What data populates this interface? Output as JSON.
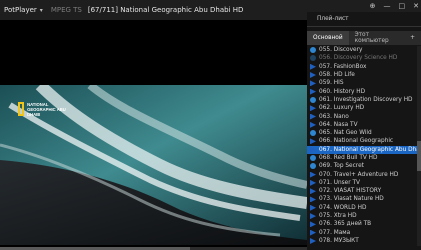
{
  "app": {
    "name": "PotPlayer",
    "format": "MPEG TS",
    "title": "[67/711] National Geographic Abu Dhabi HD"
  },
  "video": {
    "logo": "NATIONAL GEOGRAPHIC ABU DHABI",
    "progress": 0.62
  },
  "panel": {
    "title": "Плей-лист",
    "tabs": [
      {
        "label": "Основной",
        "active": true
      },
      {
        "label": "Этот компьютер",
        "active": false
      }
    ],
    "add_label": "+",
    "items": [
      {
        "label": "055. Discovery",
        "icon": "ie"
      },
      {
        "label": "056. Discovery Science HD",
        "icon": "ie",
        "dim": true
      },
      {
        "label": "057. FashionBox",
        "icon": "file"
      },
      {
        "label": "058. HD Life",
        "icon": "file"
      },
      {
        "label": "059. HIS",
        "icon": "file"
      },
      {
        "label": "060. History HD",
        "icon": "file"
      },
      {
        "label": "061. Investigation Discovery HD",
        "icon": "ie"
      },
      {
        "label": "062. Luxury HD",
        "icon": "file"
      },
      {
        "label": "063. Nano",
        "icon": "file"
      },
      {
        "label": "064. Nasa TV",
        "icon": "file"
      },
      {
        "label": "065. Nat Geo Wild",
        "icon": "ie"
      },
      {
        "label": "066. National Geographic",
        "icon": "file"
      },
      {
        "label": "067. National Geographic Abu Dhabi HD",
        "icon": "file",
        "selected": true
      },
      {
        "label": "068. Red Bull TV HD",
        "icon": "ie"
      },
      {
        "label": "069. Top Secret",
        "icon": "ie"
      },
      {
        "label": "070. Travel+ Adventure HD",
        "icon": "file"
      },
      {
        "label": "071. Unser TV",
        "icon": "file"
      },
      {
        "label": "072. VIASAT HISTORY",
        "icon": "file"
      },
      {
        "label": "073. Viasat Nature HD",
        "icon": "file"
      },
      {
        "label": "074. WORLD HD",
        "icon": "file"
      },
      {
        "label": "075. Xtra HD",
        "icon": "file"
      },
      {
        "label": "076. 365 дней ТВ",
        "icon": "file"
      },
      {
        "label": "077. Мама",
        "icon": "file"
      },
      {
        "label": "078. МУЗЫКТ",
        "icon": "file"
      }
    ]
  }
}
